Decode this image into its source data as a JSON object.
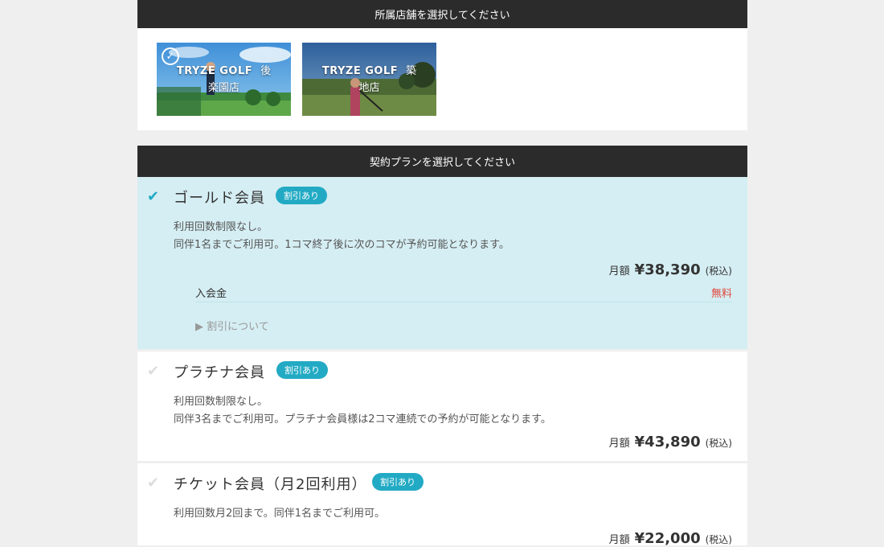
{
  "store_section": {
    "title": "所属店舗を選択してください",
    "stores": [
      {
        "brand": "TRYZE GOLF",
        "name": "後楽園店",
        "selected": true
      },
      {
        "brand": "TRYZE GOLF",
        "name": "築地店",
        "selected": false
      }
    ]
  },
  "plan_section": {
    "title": "契約プランを選択してください",
    "plans": [
      {
        "name": "ゴールド会員",
        "badge": "割引あり",
        "desc1": "利用回数制限なし。",
        "desc2": "同伴1名までご利用可。1コマ終了後に次のコマが予約可能となります。",
        "price_prefix": "月額",
        "price": "¥38,390",
        "tax": "(税込)",
        "fee_label": "入会金",
        "fee_value": "無料",
        "discount_link": "▶ 割引について",
        "selected": true
      },
      {
        "name": "プラチナ会員",
        "badge": "割引あり",
        "desc1": "利用回数制限なし。",
        "desc2": "同伴3名までご利用可。プラチナ会員様は2コマ連続での予約が可能となります。",
        "price_prefix": "月額",
        "price": "¥43,890",
        "tax": "(税込)",
        "selected": false
      },
      {
        "name": "チケット会員（月2回利用）",
        "badge": "割引あり",
        "desc1": "利用回数月2回まで。同伴1名までご利用可。",
        "price_prefix": "月額",
        "price": "¥22,000",
        "tax": "(税込)",
        "selected": false
      }
    ]
  },
  "colors": {
    "accent": "#22aac4",
    "selected_bg": "#d5eef3",
    "header_bg": "#2b2b2b",
    "free_red": "#e0473b"
  },
  "icons": {
    "store_check": "check-circle-icon",
    "plan_check": "checkmark-icon",
    "discount_arrow": "triangle-right-icon"
  }
}
